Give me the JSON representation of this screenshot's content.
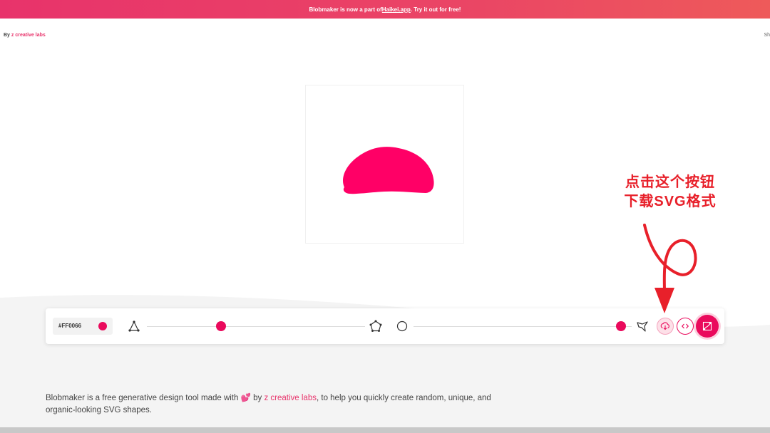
{
  "banner": {
    "prefix": "Blobmaker is now a part of ",
    "link": "Haikei.app",
    "suffix": ". Try it out for free!"
  },
  "header": {
    "by": "By ",
    "brand": "z creative labs",
    "share": "Sh"
  },
  "blob": {
    "color": "#FF0066"
  },
  "toolbar": {
    "color_code": "#FF0066",
    "accent": "#ea0a5c",
    "complexity_icon_left": "triangle-nodes-icon",
    "complexity_icon_right": "star-pentagon-icon",
    "contrast_icon_left": "circle-outline-icon",
    "contrast_icon_right": "spiky-shape-icon",
    "complexity_level": 0.34,
    "contrast_level": 0.95
  },
  "buttons": {
    "download": "download-icon",
    "code": "code-icon",
    "generate": "random-shape-icon"
  },
  "annotation": {
    "line1": "点击这个按钮",
    "line2": "下载SVG格式"
  },
  "description": {
    "part1": "Blobmaker is a free generative design tool made with ",
    "emoji": "💕",
    "part2": " by ",
    "link": "z creative labs",
    "part3": ", to help you quickly create random, unique, and",
    "line2": "organic-looking SVG shapes."
  }
}
